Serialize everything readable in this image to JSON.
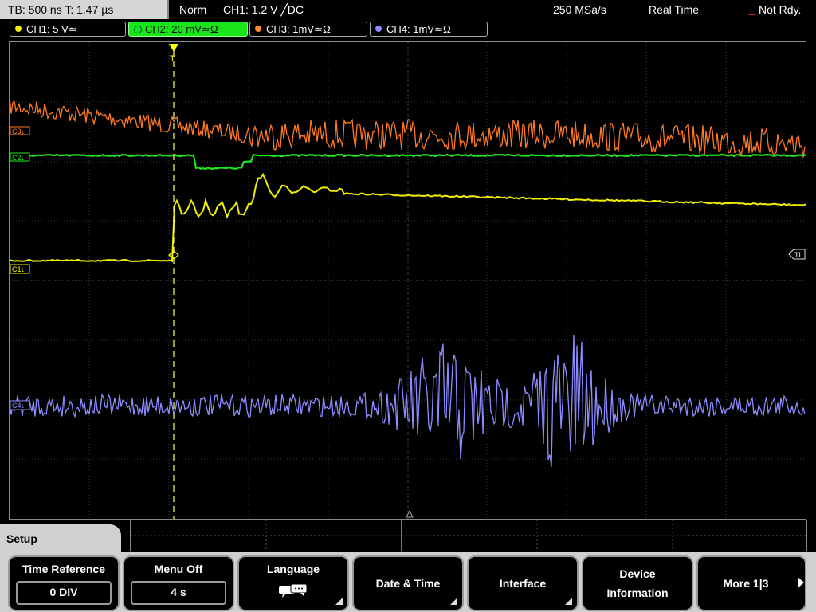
{
  "topbar": {
    "timebase": "TB: 500 ns   T: 1.47 µs",
    "mode": "Norm",
    "trigger": "CH1: 1.2 V ╱DC",
    "sample_rate": "250 MSa/s",
    "acq_mode": "Real Time",
    "status": "Not Rdy."
  },
  "channels": [
    {
      "label": "CH1: 5 V≃",
      "color": "#f0f000"
    },
    {
      "label": "CH2: 20 mV≃Ω",
      "color": "#19e619"
    },
    {
      "label": "CH3: 1mV≃Ω",
      "color": "#ff8a2a"
    },
    {
      "label": "CH4: 1mV≃Ω",
      "color": "#8c8cff"
    }
  ],
  "markers": {
    "c1": "C1↓",
    "c2": "C2↓",
    "c3": "C3↓",
    "c4": "C4↓",
    "tl": "TL",
    "trigger": "T"
  },
  "menu": {
    "title": "Setup",
    "softkeys": [
      {
        "label": "Time Reference",
        "value": "0 DIV"
      },
      {
        "label": "Menu Off",
        "value": "4 s"
      },
      {
        "label": "Language",
        "icon": "speech-bubbles-icon"
      },
      {
        "label": "Date & Time"
      },
      {
        "label": "Interface"
      },
      {
        "label": "Device",
        "label2": "Information"
      },
      {
        "label": "More 1|3"
      }
    ]
  }
}
